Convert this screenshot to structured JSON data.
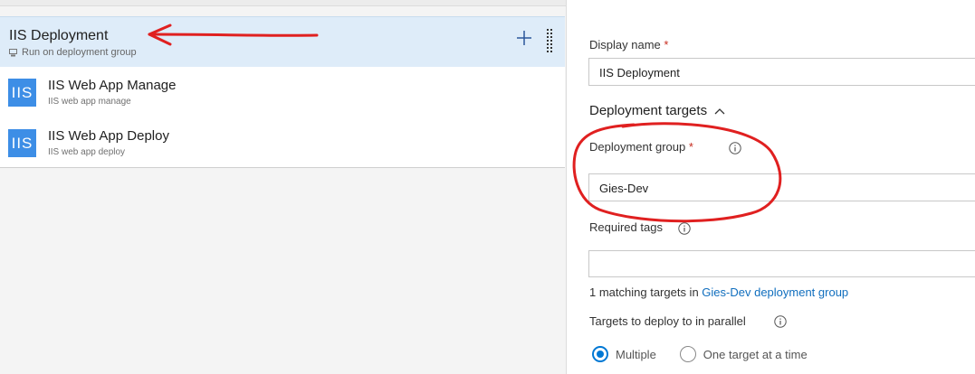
{
  "phase": {
    "title": "IIS Deployment",
    "subtitle": "Run on deployment group"
  },
  "tasks": [
    {
      "title": "IIS Web App Manage",
      "subtitle": "IIS web app manage",
      "icon_text": "IIS"
    },
    {
      "title": "IIS Web App Deploy",
      "subtitle": "IIS web app deploy",
      "icon_text": "IIS"
    }
  ],
  "form": {
    "display_name_label": "Display name",
    "display_name_value": "IIS Deployment",
    "required_marker": "*",
    "section_title": "Deployment targets",
    "deployment_group_label": "Deployment group",
    "deployment_group_value": "Gies-Dev",
    "required_tags_label": "Required tags",
    "required_tags_value": "",
    "match_prefix": "1 matching targets in ",
    "match_link": "Gies-Dev deployment group",
    "parallel_label": "Targets to deploy to in parallel",
    "radio_options": [
      "Multiple",
      "One target at a time"
    ],
    "radio_selected": "Multiple"
  },
  "colors": {
    "accent": "#0078d4",
    "selected_row": "#deecf9",
    "task_icon": "#3d8ee6",
    "annotation": "#e02020"
  }
}
